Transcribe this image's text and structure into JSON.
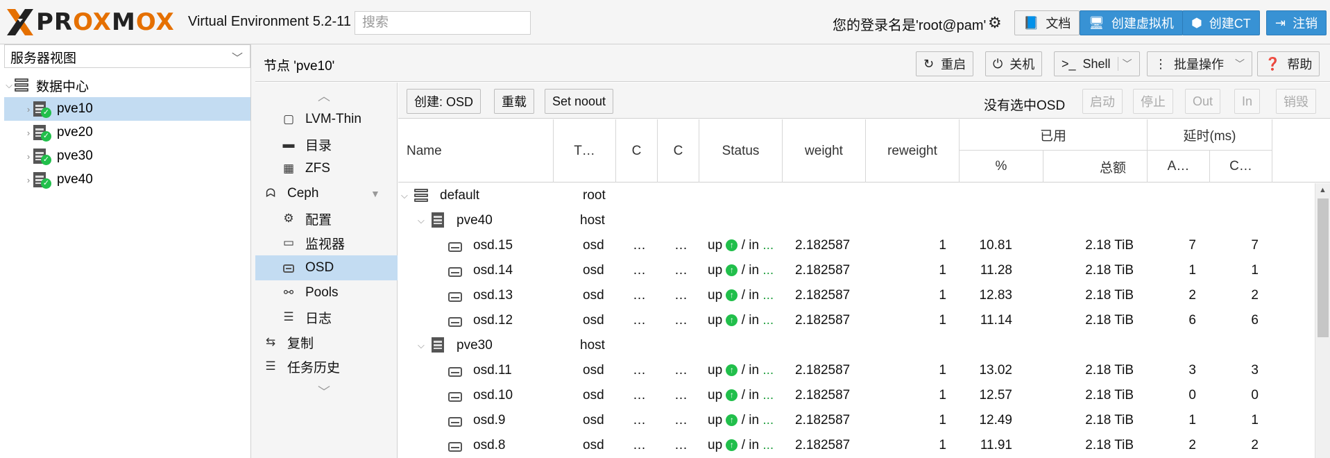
{
  "header": {
    "logo_text_a": "PR",
    "logo_text_ox": "OX",
    "logo_text_m": "M",
    "logo_text_ox2": "OX",
    "version": "Virtual Environment 5.2-11",
    "search_placeholder": "搜索",
    "login_text": "您的登录名是'root@pam'",
    "docs_label": "文档",
    "create_vm_label": "创建虚拟机",
    "create_ct_label": "创建CT",
    "logout_label": "注销"
  },
  "tree": {
    "view_label": "服务器视图",
    "datacenter": "数据中心",
    "nodes": [
      "pve10",
      "pve20",
      "pve30",
      "pve40"
    ],
    "selected": "pve10"
  },
  "node_toolbar": {
    "title": "节点 'pve10'",
    "reboot": "重启",
    "shutdown": "关机",
    "shell": "Shell",
    "bulk": "批量操作",
    "help": "帮助"
  },
  "menu": {
    "items": [
      {
        "label": "LVM-Thin",
        "icon": "square-icon"
      },
      {
        "label": "目录",
        "icon": "folder-icon"
      },
      {
        "label": "ZFS",
        "icon": "grid-icon"
      },
      {
        "label": "Ceph",
        "icon": "ceph-icon"
      },
      {
        "label": "配置",
        "icon": "gear-icon"
      },
      {
        "label": "监视器",
        "icon": "monitor-icon"
      },
      {
        "label": "OSD",
        "icon": "disk-icon"
      },
      {
        "label": "Pools",
        "icon": "sitemap-icon"
      },
      {
        "label": "日志",
        "icon": "list-icon"
      },
      {
        "label": "复制",
        "icon": "retweet-icon"
      },
      {
        "label": "任务历史",
        "icon": "list-icon"
      }
    ],
    "selected": "OSD"
  },
  "osd_toolbar": {
    "create": "创建: OSD",
    "reload": "重载",
    "noout": "Set noout",
    "none_selected": "没有选中OSD",
    "start": "启动",
    "stop": "停止",
    "out": "Out",
    "in": "In",
    "destroy": "销毁"
  },
  "columns": {
    "name": "Name",
    "type": "T…",
    "c1": "C",
    "c2": "C",
    "status": "Status",
    "weight": "weight",
    "reweight": "reweight",
    "used": "已用",
    "used_pct": "%",
    "used_total": "总额",
    "latency": "延时(ms)",
    "lat_a": "A…",
    "lat_c": "C…"
  },
  "rows": [
    {
      "kind": "root",
      "name": "default",
      "type": "root"
    },
    {
      "kind": "host",
      "name": "pve40",
      "type": "host"
    },
    {
      "kind": "osd",
      "name": "osd.15",
      "type": "osd",
      "c1": "…",
      "c2": "…",
      "status_up": "up",
      "status_in": "/ in",
      "status_more": "...",
      "weight": "2.182587",
      "reweight": "1",
      "pct": "10.81",
      "total": "2.18 TiB",
      "a": "7",
      "c": "7"
    },
    {
      "kind": "osd",
      "name": "osd.14",
      "type": "osd",
      "c1": "…",
      "c2": "…",
      "status_up": "up",
      "status_in": "/ in",
      "status_more": "...",
      "weight": "2.182587",
      "reweight": "1",
      "pct": "11.28",
      "total": "2.18 TiB",
      "a": "1",
      "c": "1"
    },
    {
      "kind": "osd",
      "name": "osd.13",
      "type": "osd",
      "c1": "…",
      "c2": "…",
      "status_up": "up",
      "status_in": "/ in",
      "status_more": "...",
      "weight": "2.182587",
      "reweight": "1",
      "pct": "12.83",
      "total": "2.18 TiB",
      "a": "2",
      "c": "2"
    },
    {
      "kind": "osd",
      "name": "osd.12",
      "type": "osd",
      "c1": "…",
      "c2": "…",
      "status_up": "up",
      "status_in": "/ in",
      "status_more": "...",
      "weight": "2.182587",
      "reweight": "1",
      "pct": "11.14",
      "total": "2.18 TiB",
      "a": "6",
      "c": "6"
    },
    {
      "kind": "host",
      "name": "pve30",
      "type": "host"
    },
    {
      "kind": "osd",
      "name": "osd.11",
      "type": "osd",
      "c1": "…",
      "c2": "…",
      "status_up": "up",
      "status_in": "/ in",
      "status_more": "...",
      "weight": "2.182587",
      "reweight": "1",
      "pct": "13.02",
      "total": "2.18 TiB",
      "a": "3",
      "c": "3"
    },
    {
      "kind": "osd",
      "name": "osd.10",
      "type": "osd",
      "c1": "…",
      "c2": "…",
      "status_up": "up",
      "status_in": "/ in",
      "status_more": "...",
      "weight": "2.182587",
      "reweight": "1",
      "pct": "12.57",
      "total": "2.18 TiB",
      "a": "0",
      "c": "0"
    },
    {
      "kind": "osd",
      "name": "osd.9",
      "type": "osd",
      "c1": "…",
      "c2": "…",
      "status_up": "up",
      "status_in": "/ in",
      "status_more": "...",
      "weight": "2.182587",
      "reweight": "1",
      "pct": "12.49",
      "total": "2.18 TiB",
      "a": "1",
      "c": "1"
    },
    {
      "kind": "osd",
      "name": "osd.8",
      "type": "osd",
      "c1": "…",
      "c2": "…",
      "status_up": "up",
      "status_in": "/ in",
      "status_more": "...",
      "weight": "2.182587",
      "reweight": "1",
      "pct": "11.91",
      "total": "2.18 TiB",
      "a": "2",
      "c": "2"
    }
  ],
  "colors": {
    "accent_blue": "#3892d4",
    "selection": "#c3dcf2",
    "status_green": "#21bf4b",
    "logo_orange": "#e57000"
  }
}
